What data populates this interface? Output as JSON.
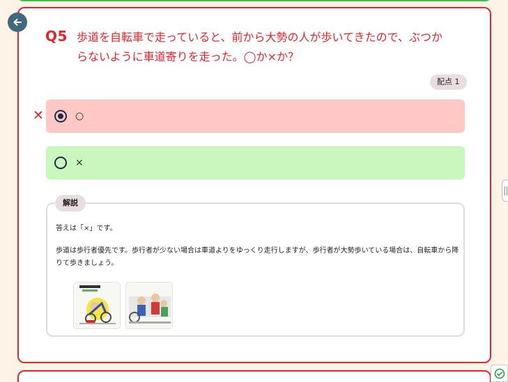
{
  "question": {
    "label": "Q5",
    "line1": "歩道を自転車で走っていると、前から大勢の人が歩いてきたので、ぶつか",
    "line2": "らないように車道寄りを走った。◯か×か？",
    "points_label": "配点 1"
  },
  "options": [
    {
      "label": "○",
      "state": "selected-wrong",
      "color": "#ffc8c5"
    },
    {
      "label": "×",
      "state": "correct",
      "color": "#caf7bd"
    }
  ],
  "wrong_mark": "✕",
  "explanation": {
    "tag": "解説",
    "answer_text": "答えは「×」です。",
    "detail_text": "歩道は歩行者優先です。歩行者が少ない場合は車道よりをゆっくり走行しますが、歩行者が大勢歩いている場合は、自転車から降りて歩きましょう。"
  },
  "colors": {
    "accent_red": "#e5252d",
    "back_button": "#41697e",
    "background": "#fdf3e6"
  },
  "icons": {
    "back": "arrow-left-icon",
    "check": "check-circle-icon",
    "handle": "side-handle-icon"
  }
}
